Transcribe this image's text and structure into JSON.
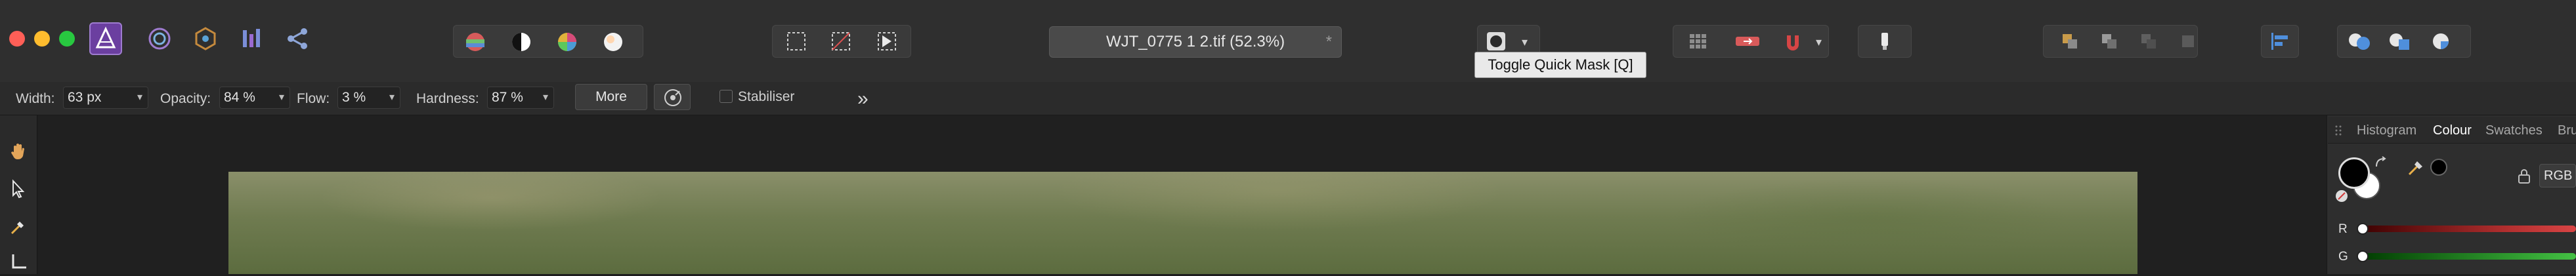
{
  "window": {
    "traffic_lights": {
      "close": "#ff5f57",
      "minimize": "#febc2e",
      "zoom": "#28c840"
    }
  },
  "toolbar": {
    "studio_icons": [
      "photo-persona-icon",
      "liquify-persona-icon",
      "develop-persona-icon",
      "tone-mapping-persona-icon",
      "export-persona-icon"
    ],
    "document_title": "WJT_0775 1 2.tif (52.3%)",
    "document_modified_mark": "*"
  },
  "tooltip": {
    "text": "Toggle Quick Mask [Q]"
  },
  "context_toolbar": {
    "width_label": "Width:",
    "width_value": "63 px",
    "opacity_label": "Opacity:",
    "opacity_value": "84 %",
    "flow_label": "Flow:",
    "flow_value": "3 %",
    "hardness_label": "Hardness:",
    "hardness_value": "87 %",
    "more_label": "More",
    "stabiliser_label": "Stabiliser",
    "expand_glyph": "»"
  },
  "panel": {
    "tabs": [
      "Histogram",
      "Colour",
      "Swatches",
      "Bru"
    ],
    "active_tab": "Colour",
    "color_model": "RGB",
    "sliders": [
      {
        "label": "R",
        "value": 0
      },
      {
        "label": "G",
        "value": 0
      }
    ],
    "primary_color": "#000000",
    "secondary_color": "#ffffff"
  },
  "colors": {
    "accent": "#6b3fa0",
    "toolbar_bg": "#2f2f2f"
  }
}
